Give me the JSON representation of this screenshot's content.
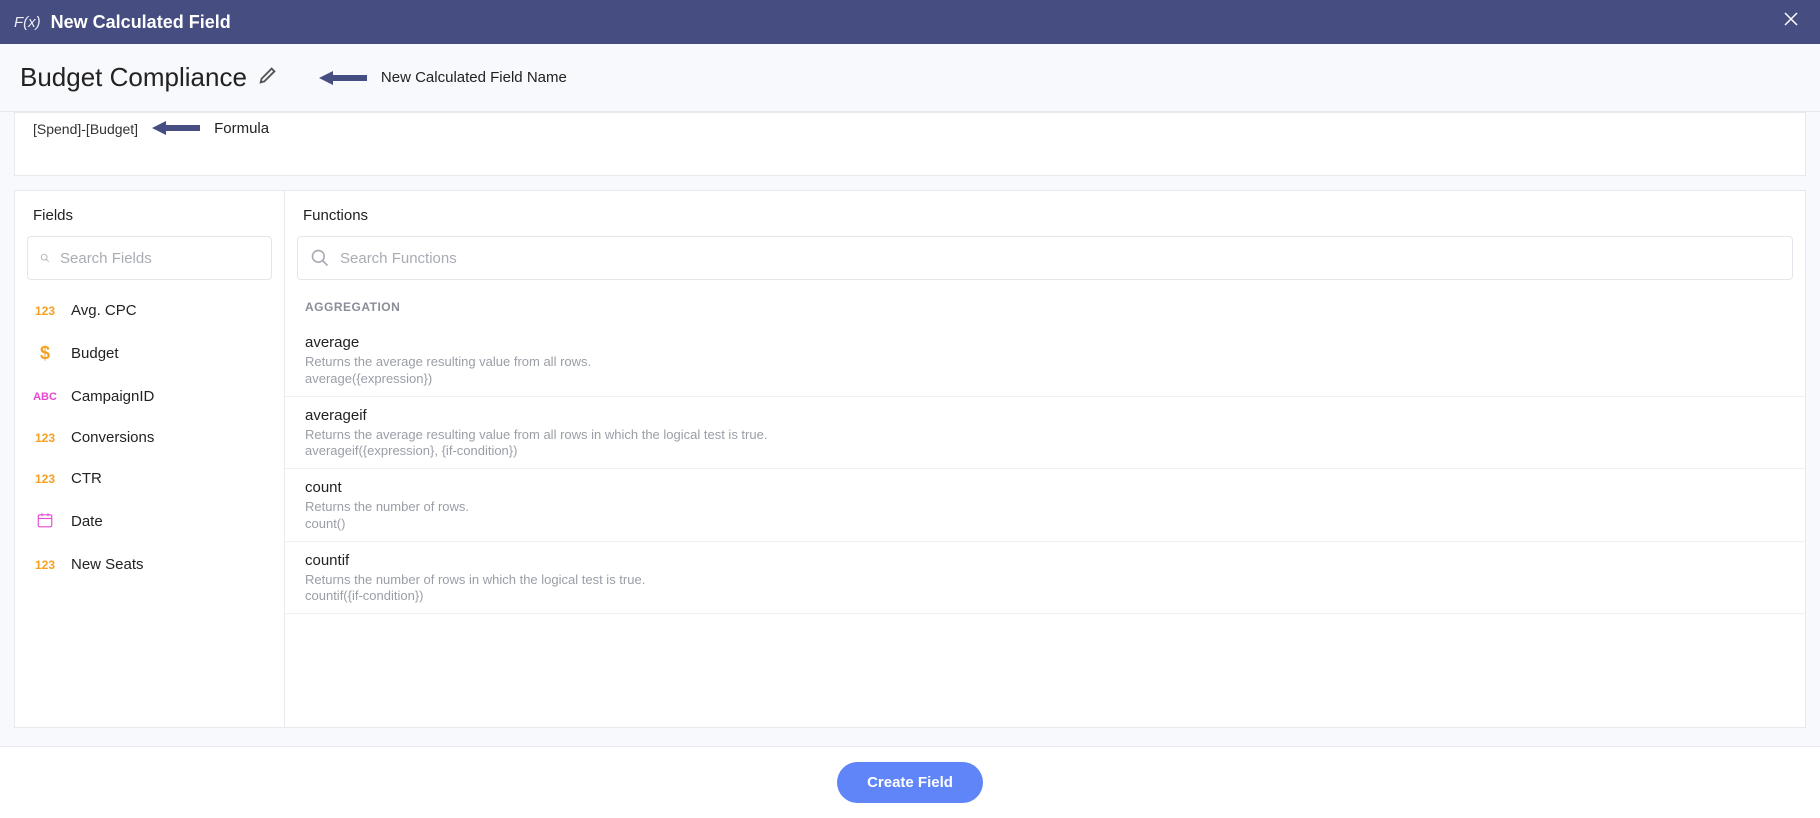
{
  "titlebar": {
    "fx": "F(x)",
    "title": "New Calculated Field"
  },
  "nameRow": {
    "fieldName": "Budget Compliance",
    "annot": "New Calculated Field Name"
  },
  "formula": {
    "text": "[Spend]-[Budget]",
    "annot": "Formula"
  },
  "fieldsPanel": {
    "title": "Fields",
    "searchPlaceholder": "Search Fields",
    "items": [
      {
        "type": "num",
        "typeLabel": "123",
        "label": "Avg. CPC"
      },
      {
        "type": "dollar",
        "typeLabel": "$",
        "label": "Budget"
      },
      {
        "type": "abc",
        "typeLabel": "ABC",
        "label": "CampaignID"
      },
      {
        "type": "num",
        "typeLabel": "123",
        "label": "Conversions"
      },
      {
        "type": "num",
        "typeLabel": "123",
        "label": "CTR"
      },
      {
        "type": "date",
        "typeLabel": "",
        "label": "Date"
      },
      {
        "type": "num",
        "typeLabel": "123",
        "label": "New Seats"
      }
    ]
  },
  "functionsPanel": {
    "title": "Functions",
    "searchPlaceholder": "Search Functions",
    "sectionTitle": "AGGREGATION",
    "items": [
      {
        "name": "average",
        "desc": "Returns the average resulting value from all rows.",
        "sig": "average({expression})"
      },
      {
        "name": "averageif",
        "desc": "Returns the average resulting value from all rows in which the logical test is true.",
        "sig": "averageif({expression}, {if-condition})"
      },
      {
        "name": "count",
        "desc": "Returns the number of rows.",
        "sig": "count()"
      },
      {
        "name": "countif",
        "desc": "Returns the number of rows in which the logical test is true.",
        "sig": "countif({if-condition})"
      }
    ]
  },
  "footer": {
    "createLabel": "Create Field"
  }
}
